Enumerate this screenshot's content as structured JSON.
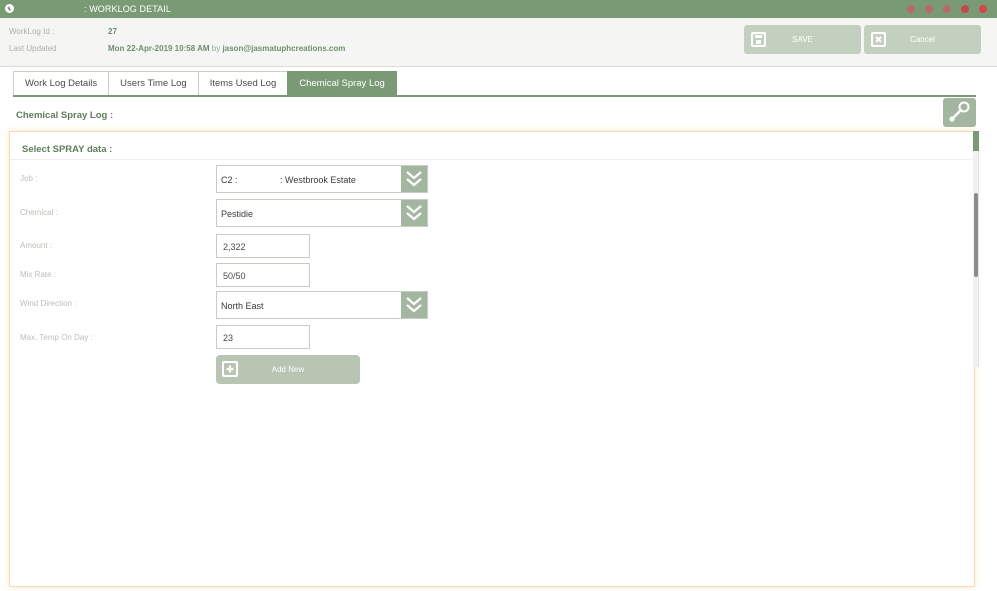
{
  "window": {
    "title": ": WORKLOG DETAIL",
    "controls": [
      {
        "name": "window-control-1",
        "color": "#b86a6a"
      },
      {
        "name": "window-control-2",
        "color": "#b86a6a"
      },
      {
        "name": "window-control-3",
        "color": "#b86a6a"
      },
      {
        "name": "window-control-4",
        "color": "#c44a4a"
      },
      {
        "name": "window-control-5",
        "color": "#d14a4a"
      }
    ]
  },
  "header": {
    "worklog_id_label": "WorkLog Id :",
    "worklog_id_value": "27",
    "last_updated_label": "Last Updated",
    "last_updated_value": "Mon 22-Apr-2019 10:58 AM",
    "by_text": "by",
    "updated_by": "jason@jasmatuphcreations.com",
    "save_label": "SAVE",
    "cancel_label": "Cancel"
  },
  "tabs": [
    {
      "label": "Work Log Details",
      "active": false
    },
    {
      "label": "Users Time Log",
      "active": false
    },
    {
      "label": "Items Used Log",
      "active": false
    },
    {
      "label": "Chemical Spray Log",
      "active": true
    }
  ],
  "section": {
    "title": "Chemical Spray Log :"
  },
  "panel": {
    "title": "Select SPRAY data :",
    "fields": {
      "job": {
        "label": "Job :",
        "value": "C2 :                 : Westbrook Estate"
      },
      "chemical": {
        "label": "Chemical :",
        "value": "Pestidie"
      },
      "amount": {
        "label": "Amount :",
        "value": "2,322"
      },
      "mix_rate": {
        "label": "Mix Rate :",
        "value": "50/50"
      },
      "wind_direction": {
        "label": "Wind Direction :",
        "value": "North East"
      },
      "max_temp": {
        "label": "Max. Temp On Day :",
        "value": "23"
      }
    },
    "add_label": "Add New"
  },
  "colors": {
    "accent": "#7a9a76",
    "button": "#a3b69f",
    "button_disabled": "#c4d0bf",
    "label": "#5f7d5c",
    "panel_border": "#f6dcb4"
  }
}
